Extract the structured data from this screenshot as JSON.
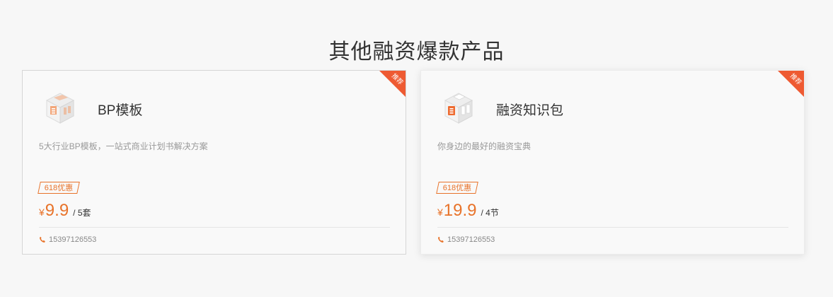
{
  "section": {
    "title": "其他融资爆款产品"
  },
  "colors": {
    "accent": "#e8732a",
    "ribbon": "#ee5a32"
  },
  "products": [
    {
      "badge": "推荐",
      "icon": "bp-template-box-icon",
      "name": "BP模板",
      "description": "5大行业BP模板，一站式商业计划书解决方案",
      "promo": "618优惠",
      "currency": "¥",
      "price": "9.9",
      "unit": "/ 5套",
      "phone": "15397126553"
    },
    {
      "badge": "推荐",
      "icon": "financing-knowledge-box-icon",
      "name": "融资知识包",
      "description": "你身边的最好的融资宝典",
      "promo": "618优惠",
      "currency": "¥",
      "price": "19.9",
      "unit": "/ 4节",
      "phone": "15397126553"
    }
  ]
}
